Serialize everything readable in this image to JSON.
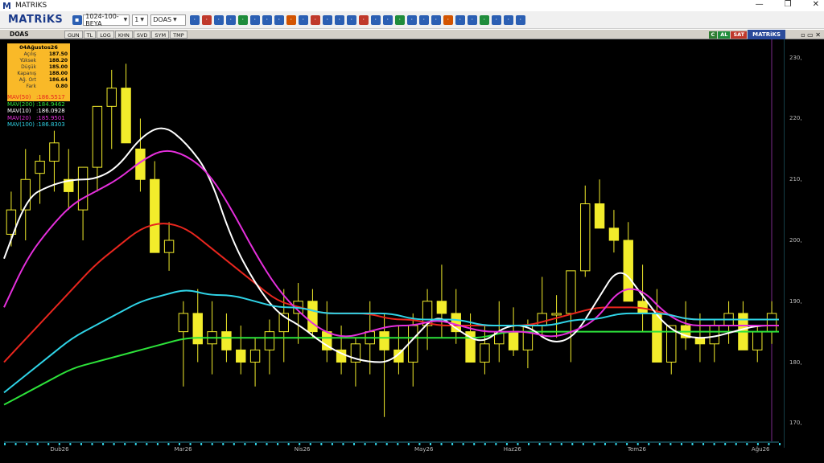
{
  "window": {
    "title": "MATRIKS",
    "minimize": "—",
    "maximize": "❐",
    "close": "✕"
  },
  "toolbar": {
    "brand": "MATRiKS",
    "template_value": "1024-100-BEYA",
    "number_value": "1",
    "symbol_value": "DOAS",
    "icons": [
      "save-icon",
      "layout-icon",
      "zoom-icon",
      "search-icon",
      "chart-icon",
      "indicator-icon",
      "clock-icon",
      "list-icon",
      "news-icon",
      "bold-icon",
      "alert-icon",
      "u-icon",
      "settings-icon",
      "scanner-icon",
      "mail-icon",
      "formula-icon",
      "compare-icon",
      "table-icon",
      "info-icon",
      "search2-icon",
      "tool-icon",
      "line-icon",
      "rect-icon",
      "pencil-icon",
      "refresh-icon",
      "bell-icon",
      "calc-icon",
      "gear-icon"
    ],
    "icon_colors": [
      "#2b5fb3",
      "#c0392b",
      "#2b5fb3",
      "#2b5fb3",
      "#1f8c3b",
      "#2b5fb3",
      "#2b5fb3",
      "#2b5fb3",
      "#d35400",
      "#2b5fb3",
      "#c0392b",
      "#2b5fb3",
      "#2b5fb3",
      "#2b5fb3",
      "#c0392b",
      "#2b5fb3",
      "#2b5fb3",
      "#1f8c3b",
      "#2b5fb3",
      "#2b5fb3",
      "#2b5fb3",
      "#d35400",
      "#2b5fb3",
      "#2b5fb3",
      "#1f8c3b",
      "#2b5fb3",
      "#2b5fb3",
      "#2b5fb3"
    ]
  },
  "chart_header": {
    "symbol": "DOAS",
    "tabs": [
      "GUN",
      "TL",
      "LOG",
      "KHN",
      "SVD",
      "SYM",
      "TMP"
    ],
    "buttons": [
      "C",
      "AL",
      "SAT"
    ],
    "button_colors": [
      "#2f7d32",
      "#1f8c3b",
      "#c0392b"
    ],
    "chart_name": "MATRiKS"
  },
  "info_box": {
    "date": "04Ağustos26",
    "rows": [
      {
        "k": "Açılış",
        "v": "187.50"
      },
      {
        "k": "Yüksek",
        "v": "188.20"
      },
      {
        "k": "Düşük",
        "v": "185.00"
      },
      {
        "k": "Kapanış",
        "v": "188.00"
      },
      {
        "k": "Ağ. Ort",
        "v": "186.64"
      },
      {
        "k": "Fark",
        "v": "0.80"
      }
    ]
  },
  "legend": [
    {
      "name": "MAV(50)",
      "value": ":186.5517",
      "color": "#e8261e"
    },
    {
      "name": "MAV(200)",
      "value": ":184.9462",
      "color": "#2de23a"
    },
    {
      "name": "MAV(10)",
      "value": ":186.0928",
      "color": "#ffffff"
    },
    {
      "name": "MAV(20)",
      "value": ":185.9501",
      "color": "#e52fdc"
    },
    {
      "name": "MAV(100)",
      "value": ":186.8303",
      "color": "#2fd3e6"
    }
  ],
  "chart_data": {
    "type": "line",
    "candle_color": "#f2ec2b",
    "price_axis": [
      "230,",
      "220,",
      "210,",
      "200,",
      "190,",
      "180,",
      "170,"
    ],
    "price_ticks": [
      230,
      220,
      210,
      200,
      190,
      180,
      170
    ],
    "ylim": [
      167,
      233
    ],
    "date_labels": [
      "Dub26",
      "Mar26",
      "Nis26",
      "May26",
      "Haz26",
      "Tem26",
      "Ağu26"
    ],
    "date_positions": [
      0.07,
      0.23,
      0.385,
      0.54,
      0.655,
      0.815,
      0.975
    ],
    "series": [
      {
        "name": "MAV(50)",
        "color": "#e8261e",
        "values": [
          180,
          184,
          188,
          192,
          196,
          199,
          202,
          203,
          202,
          199,
          196,
          193,
          190,
          189,
          188,
          188,
          188,
          187,
          187,
          186,
          186,
          186,
          186,
          186,
          187,
          188,
          189,
          189,
          189,
          188,
          187,
          187,
          187,
          187,
          187
        ]
      },
      {
        "name": "MAV(200)",
        "color": "#2de23a",
        "values": [
          173,
          175,
          177,
          179,
          180,
          181,
          182,
          183,
          184,
          184,
          184,
          184,
          184,
          184,
          184,
          184,
          184,
          184,
          184,
          184,
          184,
          184,
          185,
          185,
          185,
          185,
          185,
          185,
          185,
          185,
          185,
          185,
          185,
          185,
          185
        ]
      },
      {
        "name": "MAV(10)",
        "color": "#ffffff",
        "values": [
          197,
          207,
          209,
          210,
          210,
          212,
          217,
          219,
          216,
          211,
          200,
          193,
          188,
          186,
          183,
          181,
          180,
          180,
          184,
          188,
          185,
          183,
          186,
          186,
          183,
          184,
          190,
          196,
          191,
          186,
          184,
          184,
          185,
          186,
          186
        ]
      },
      {
        "name": "MAV(20)",
        "color": "#e52fdc",
        "values": [
          189,
          197,
          202,
          206,
          208,
          210,
          213,
          215,
          214,
          211,
          205,
          198,
          192,
          188,
          185,
          184,
          185,
          186,
          186,
          187,
          186,
          185,
          185,
          185,
          184,
          185,
          187,
          192,
          192,
          188,
          186,
          186,
          186,
          186,
          186
        ]
      },
      {
        "name": "MAV(100)",
        "color": "#2fd3e6",
        "values": [
          175,
          178,
          181,
          184,
          186,
          188,
          190,
          191,
          192,
          191,
          191,
          190,
          189,
          189,
          188,
          188,
          188,
          188,
          187,
          187,
          187,
          186,
          186,
          186,
          186,
          187,
          187,
          188,
          188,
          188,
          187,
          187,
          187,
          187,
          187
        ]
      }
    ],
    "candles": [
      [
        201,
        208,
        199,
        205
      ],
      [
        205,
        215,
        200,
        210
      ],
      [
        211,
        214,
        206,
        213
      ],
      [
        213,
        218,
        208,
        216
      ],
      [
        210,
        215,
        205,
        208
      ],
      [
        205,
        210,
        200,
        212
      ],
      [
        212,
        218,
        208,
        222
      ],
      [
        222,
        228,
        215,
        225
      ],
      [
        225,
        229,
        218,
        216
      ],
      [
        215,
        220,
        208,
        210
      ],
      [
        210,
        213,
        202,
        198
      ],
      [
        198,
        203,
        195,
        200
      ],
      [
        185,
        190,
        176,
        188
      ],
      [
        188,
        192,
        180,
        183
      ],
      [
        183,
        190,
        178,
        185
      ],
      [
        185,
        188,
        180,
        182
      ],
      [
        182,
        186,
        178,
        180
      ],
      [
        180,
        184,
        176,
        182
      ],
      [
        182,
        187,
        178,
        185
      ],
      [
        185,
        192,
        180,
        188
      ],
      [
        188,
        193,
        183,
        190
      ],
      [
        190,
        192,
        184,
        185
      ],
      [
        185,
        190,
        180,
        182
      ],
      [
        182,
        186,
        178,
        180
      ],
      [
        180,
        184,
        176,
        183
      ],
      [
        183,
        190,
        178,
        185
      ],
      [
        185,
        188,
        171,
        182
      ],
      [
        182,
        186,
        178,
        180
      ],
      [
        180,
        188,
        176,
        186
      ],
      [
        186,
        192,
        182,
        190
      ],
      [
        190,
        196,
        184,
        188
      ],
      [
        188,
        192,
        183,
        185
      ],
      [
        185,
        188,
        180,
        180
      ],
      [
        180,
        186,
        178,
        183
      ],
      [
        183,
        190,
        180,
        185
      ],
      [
        185,
        189,
        181,
        182
      ],
      [
        182,
        187,
        179,
        186
      ],
      [
        186,
        194,
        184,
        188
      ],
      [
        188,
        191,
        184,
        188
      ],
      [
        188,
        195,
        180,
        195
      ],
      [
        195,
        209,
        194,
        206
      ],
      [
        206,
        210,
        202,
        202
      ],
      [
        202,
        205,
        198,
        200
      ],
      [
        200,
        203,
        196,
        190
      ],
      [
        190,
        196,
        185,
        188
      ],
      [
        188,
        192,
        182,
        180
      ],
      [
        180,
        186,
        178,
        186
      ],
      [
        186,
        190,
        182,
        184
      ],
      [
        184,
        188,
        180,
        183
      ],
      [
        183,
        187,
        180,
        186
      ],
      [
        186,
        190,
        183,
        188
      ],
      [
        188,
        190,
        184,
        182
      ],
      [
        182,
        186,
        180,
        185
      ],
      [
        185,
        190,
        183,
        188
      ]
    ]
  }
}
